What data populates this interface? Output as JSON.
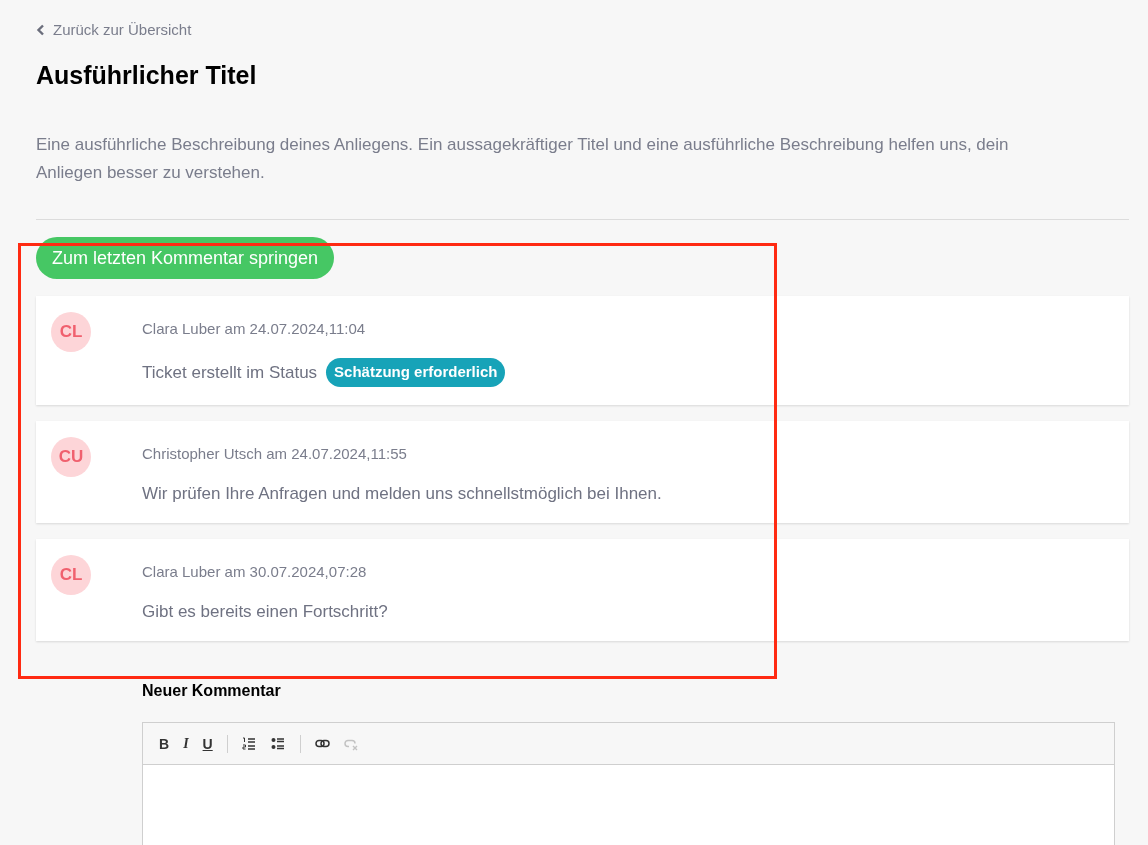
{
  "back_link": {
    "label": "Zurück zur Übersicht"
  },
  "title": "Ausführlicher Titel",
  "description": "Eine ausführliche Beschreibung deines Anliegens. Ein aussagekräftiger Titel und eine ausführliche Beschreibung helfen uns, dein Anliegen besser zu verstehen.",
  "jump_button": "Zum letzten Kommentar springen",
  "comments": [
    {
      "initials": "CL",
      "meta": "Clara Luber am 24.07.2024,11:04",
      "text": "Ticket erstellt im Status",
      "status_badge": "Schätzung erforderlich"
    },
    {
      "initials": "CU",
      "meta": "Christopher Utsch am 24.07.2024,11:55",
      "text": "Wir prüfen Ihre Anfragen und melden uns schnellstmöglich bei Ihnen."
    },
    {
      "initials": "CL",
      "meta": "Clara Luber am 30.07.2024,07:28",
      "text": "Gibt es bereits einen Fortschritt?"
    }
  ],
  "new_comment": {
    "label": "Neuer Kommentar",
    "toolbar": [
      {
        "kind": "bold",
        "glyph": "B",
        "disabled": false
      },
      {
        "kind": "italic",
        "glyph": "I",
        "disabled": false
      },
      {
        "kind": "underline",
        "glyph": "U",
        "disabled": false
      },
      {
        "kind": "separator"
      },
      {
        "kind": "ordered-list",
        "disabled": false
      },
      {
        "kind": "bullet-list",
        "disabled": false
      },
      {
        "kind": "separator"
      },
      {
        "kind": "link",
        "disabled": false
      },
      {
        "kind": "unlink",
        "disabled": true
      }
    ]
  }
}
